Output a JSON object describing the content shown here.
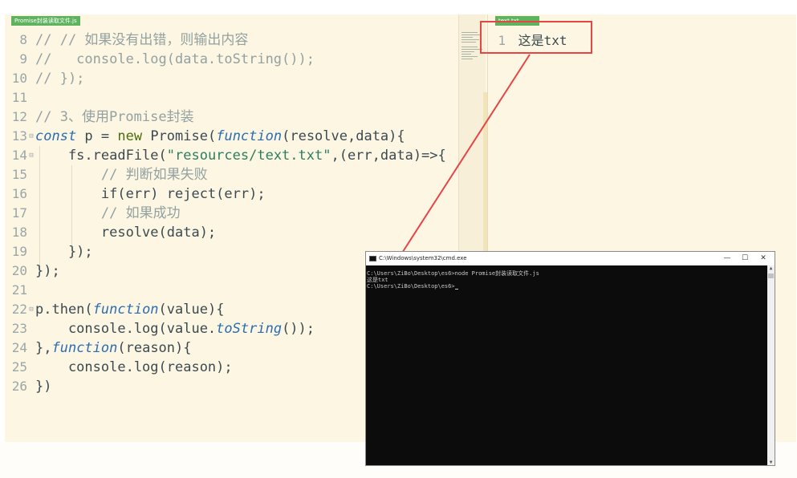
{
  "editor": {
    "left_tab": "Promise封装读取文件.js",
    "right_tab": "text.txt",
    "lines": [
      {
        "n": "8",
        "fold": false,
        "seg": [
          [
            "cm",
            "// // 如果没有出错，则输出内容"
          ]
        ]
      },
      {
        "n": "9",
        "fold": false,
        "seg": [
          [
            "cm",
            "//   console.log(data.toString());"
          ]
        ]
      },
      {
        "n": "10",
        "fold": false,
        "seg": [
          [
            "cm",
            "// });"
          ]
        ]
      },
      {
        "n": "11",
        "fold": false,
        "seg": []
      },
      {
        "n": "12",
        "fold": false,
        "seg": [
          [
            "cm",
            "// 3、使用Promise封装"
          ]
        ]
      },
      {
        "n": "13",
        "fold": true,
        "seg": [
          [
            "kw",
            "const"
          ],
          [
            "plain",
            " p = "
          ],
          [
            "kn",
            "new"
          ],
          [
            "plain",
            " Promise("
          ],
          [
            "fn",
            "function"
          ],
          [
            "plain",
            "(resolve,data){"
          ]
        ]
      },
      {
        "n": "14",
        "fold": true,
        "seg": [
          [
            "plain",
            "    fs.readFile("
          ],
          [
            "st",
            "\"resources/text.txt\""
          ],
          [
            "plain",
            ",(err,data)=>{"
          ]
        ]
      },
      {
        "n": "15",
        "fold": false,
        "seg": [
          [
            "cm",
            "        // 判断如果失败"
          ]
        ]
      },
      {
        "n": "16",
        "fold": false,
        "seg": [
          [
            "plain",
            "        if(err) reject(err);"
          ]
        ]
      },
      {
        "n": "17",
        "fold": false,
        "seg": [
          [
            "cm",
            "        // 如果成功"
          ]
        ]
      },
      {
        "n": "18",
        "fold": false,
        "seg": [
          [
            "plain",
            "        resolve(data);"
          ]
        ]
      },
      {
        "n": "19",
        "fold": false,
        "seg": [
          [
            "plain",
            "    });"
          ]
        ]
      },
      {
        "n": "20",
        "fold": false,
        "seg": [
          [
            "plain",
            "});"
          ]
        ]
      },
      {
        "n": "21",
        "fold": false,
        "seg": []
      },
      {
        "n": "22",
        "fold": true,
        "seg": [
          [
            "plain",
            "p.then("
          ],
          [
            "fn",
            "function"
          ],
          [
            "plain",
            "(value){"
          ]
        ]
      },
      {
        "n": "23",
        "fold": false,
        "seg": [
          [
            "plain",
            "    console.log(value."
          ],
          [
            "fn",
            "toString"
          ],
          [
            "plain",
            "());"
          ]
        ]
      },
      {
        "n": "24",
        "fold": false,
        "seg": [
          [
            "plain",
            "},"
          ],
          [
            "fn",
            "function"
          ],
          [
            "plain",
            "(reason){"
          ]
        ]
      },
      {
        "n": "25",
        "fold": false,
        "seg": [
          [
            "plain",
            "    console.log(reason);"
          ]
        ]
      },
      {
        "n": "26",
        "fold": false,
        "seg": [
          [
            "plain",
            "})"
          ]
        ]
      }
    ]
  },
  "txt_file": {
    "line_number": "1",
    "content": "这是txt"
  },
  "cmd": {
    "title": "C:\\Windows\\system32\\cmd.exe",
    "minimize": "—",
    "maximize": "☐",
    "close": "✕",
    "output": [
      "C:\\Users\\ZiBo\\Desktop\\es6>node Promise封装读取文件.js",
      "这是txt",
      "",
      "C:\\Users\\ZiBo\\Desktop\\es6>"
    ]
  },
  "colors": {
    "editor_bg": "#fdf6e3",
    "annotation_red": "#e64545",
    "tab_green": "#5fb35f",
    "console_bg": "#0c0c0c"
  }
}
